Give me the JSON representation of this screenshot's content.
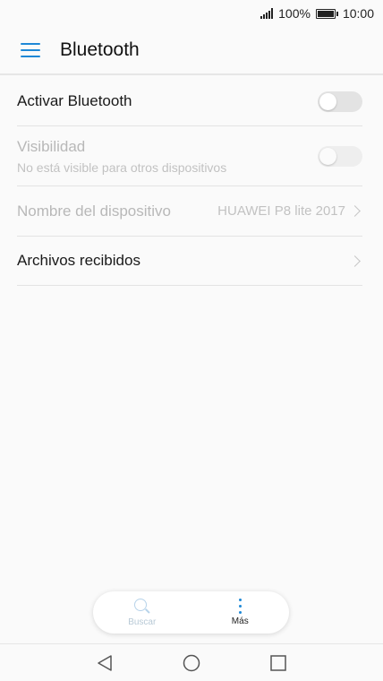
{
  "status_bar": {
    "battery": "100%",
    "time": "10:00"
  },
  "app_bar": {
    "title": "Bluetooth"
  },
  "settings": {
    "activar": {
      "label": "Activar Bluetooth"
    },
    "visibilidad": {
      "label": "Visibilidad",
      "sublabel": "No está visible para otros dispositivos"
    },
    "nombre": {
      "label": "Nombre del dispositivo",
      "value": "HUAWEI P8 lite 2017"
    },
    "archivos": {
      "label": "Archivos recibidos"
    }
  },
  "bottom_menu": {
    "search_label": "Buscar",
    "more_label": "Más"
  },
  "colors": {
    "accent": "#1e88d6",
    "disabled_text": "#b8b8b8"
  }
}
